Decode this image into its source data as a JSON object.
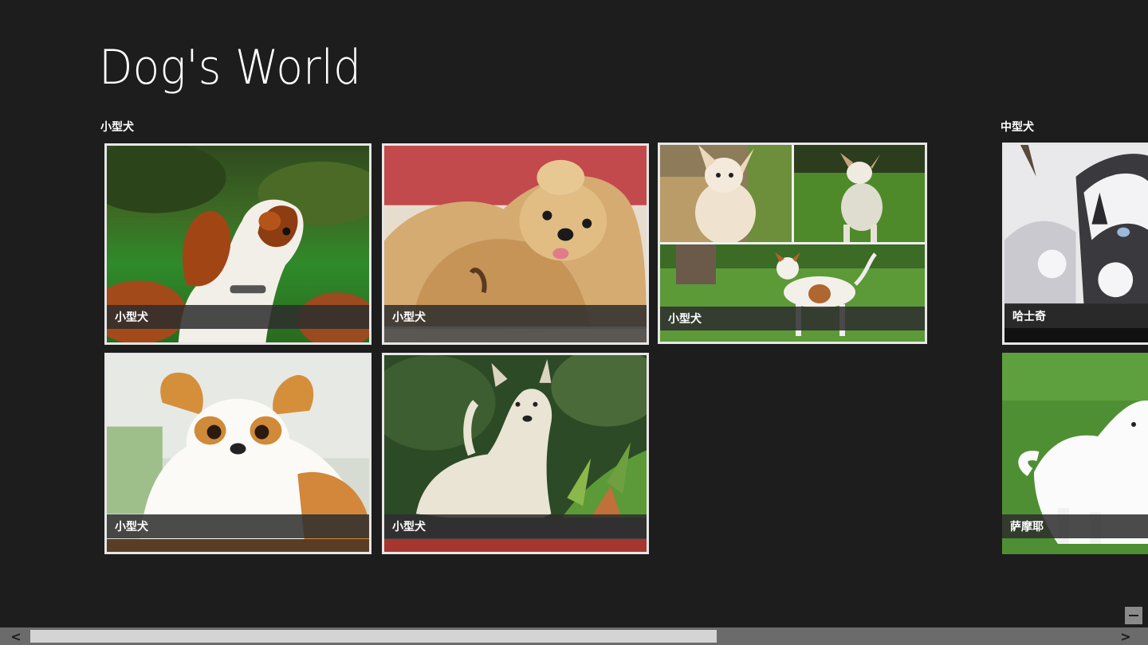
{
  "app": {
    "title": "Dog's World"
  },
  "groups": [
    {
      "header": "小型犬"
    },
    {
      "header": "中型犬"
    }
  ],
  "tiles": [
    {
      "caption": "小型犬",
      "image": "cavalier-spaniel-photo"
    },
    {
      "caption": "小型犬",
      "image": "shih-tzu-photo"
    },
    {
      "caption": "小型犬",
      "image": "chihuahua-collage"
    },
    {
      "caption": "小型犬",
      "image": "japanese-chin-photo"
    },
    {
      "caption": "小型犬",
      "image": "white-terrier-photo"
    },
    {
      "caption": "哈士奇",
      "image": "husky-in-snow-photo"
    },
    {
      "caption": "萨摩耶",
      "image": "samoyed-puppy-photo"
    }
  ],
  "scrollbar": {
    "left_arrow": "<",
    "right_arrow": ">",
    "thumb_fraction": 0.6
  },
  "zoom": {
    "icon": "minus-icon"
  },
  "colors": {
    "background": "#1d1d1d",
    "tile_border": "#e6e6e6",
    "caption_bg": "#2d2d2d",
    "scroll_track": "#6b6b6b",
    "scroll_thumb": "#d4d4d4"
  }
}
